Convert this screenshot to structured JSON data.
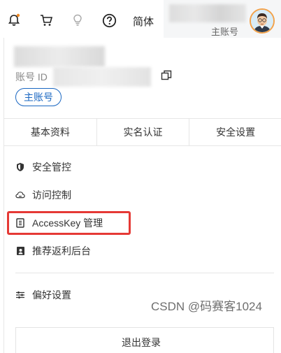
{
  "topbar": {
    "lang_label": "简体",
    "account_role": "主账号"
  },
  "account": {
    "id_label": "账号 ID",
    "badge": "主账号"
  },
  "tabs": [
    {
      "label": "基本资料"
    },
    {
      "label": "实名认证"
    },
    {
      "label": "安全设置"
    }
  ],
  "menu": {
    "security": "安全管控",
    "access": "访问控制",
    "accesskey": "AccessKey 管理",
    "rebate": "推荐返利后台",
    "prefs": "偏好设置"
  },
  "logout_label": "退出登录",
  "watermark": "CSDN @码赛客1024",
  "colors": {
    "accent_blue": "#1a67c2",
    "highlight_red": "#e53935",
    "notification_dot": "#f08a24"
  }
}
